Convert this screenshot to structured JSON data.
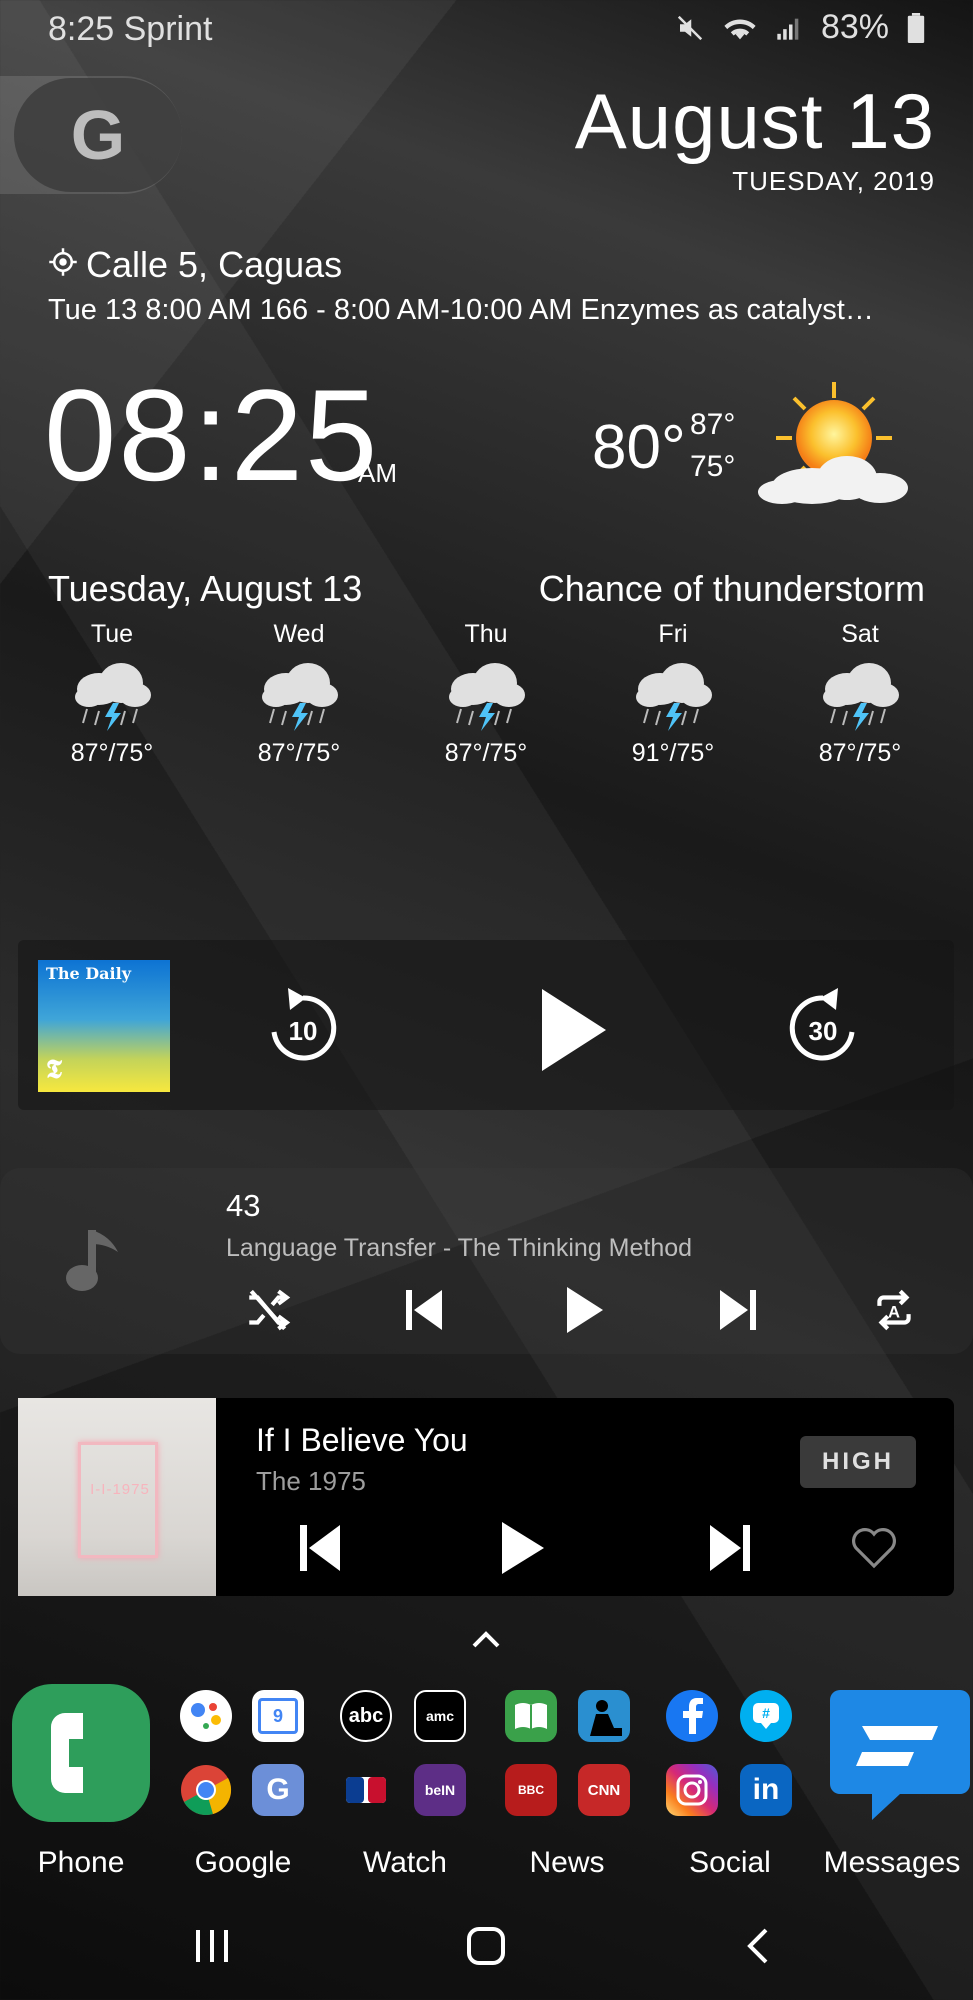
{
  "status_bar": {
    "time_carrier": "8:25 Sprint",
    "battery": "83%",
    "icons": [
      "mute-icon",
      "wifi-icon",
      "signal-icon",
      "battery-icon"
    ]
  },
  "header": {
    "google_letter": "G",
    "date": "August 13",
    "weekday_year": "TUESDAY, 2019"
  },
  "location": {
    "place": "Calle 5, Caguas",
    "event": "Tue 13 8:00 AM 166 - 8:00 AM-10:00 AM Enzymes as catalyst…"
  },
  "clock": {
    "time": "08:25",
    "ampm": "AM"
  },
  "weather": {
    "current": "80°",
    "high": "87°",
    "low": "75°",
    "date_line": "Tuesday, August 13",
    "condition": "Chance of thunderstorm",
    "forecast": [
      {
        "day": "Tue",
        "temps": "87°/75°"
      },
      {
        "day": "Wed",
        "temps": "87°/75°"
      },
      {
        "day": "Thu",
        "temps": "87°/75°"
      },
      {
        "day": "Fri",
        "temps": "91°/75°"
      },
      {
        "day": "Sat",
        "temps": "87°/75°"
      }
    ]
  },
  "podcast": {
    "art_title": "The Daily",
    "art_logo": "𝕿",
    "rewind_seconds": "10",
    "forward_seconds": "30"
  },
  "music_player_2": {
    "track": "43",
    "artist": "Language Transfer - The Thinking Method"
  },
  "now_playing": {
    "title": "If I Believe You",
    "artist": "The 1975",
    "quality_badge": "HIGH",
    "art_text": "I-I-1975"
  },
  "dock": {
    "labels": {
      "phone": "Phone",
      "google": "Google",
      "watch": "Watch",
      "news": "News",
      "social": "Social",
      "messages": "Messages"
    },
    "app_text": {
      "abc": "abc",
      "amc": "amc",
      "bein": "beIN",
      "bbc": "BBC",
      "cnn": "CNN",
      "linkedin": "in",
      "calendar": "9"
    }
  }
}
